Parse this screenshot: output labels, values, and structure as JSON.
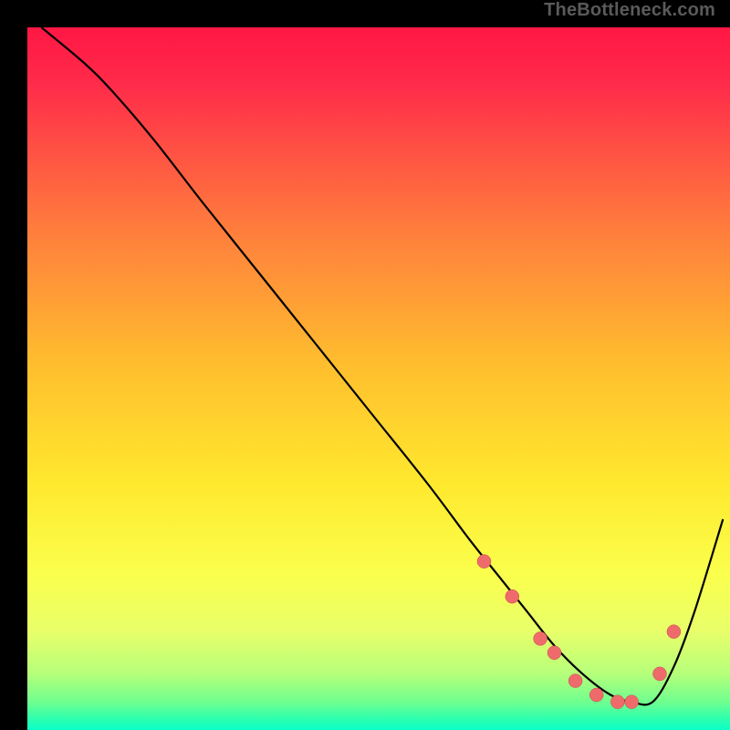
{
  "watermark": "TheBottleneck.com",
  "chart_data": {
    "type": "line",
    "title": "",
    "xlabel": "",
    "ylabel": "",
    "xlim": [
      0,
      100
    ],
    "ylim": [
      0,
      100
    ],
    "grid": false,
    "series": [
      {
        "name": "curve",
        "x": [
          2,
          8,
          12,
          18,
          25,
          33,
          41,
          49,
          57,
          63,
          67,
          71,
          75,
          79,
          83,
          86,
          89,
          92,
          95,
          99
        ],
        "y": [
          100,
          95,
          91,
          84,
          75,
          65,
          55,
          45,
          35,
          27,
          22,
          17,
          12,
          8,
          5,
          4,
          4,
          9,
          17,
          30
        ]
      }
    ],
    "markers": {
      "name": "highlight-dots",
      "x": [
        65,
        69,
        73,
        75,
        78,
        81,
        84,
        86,
        90,
        92
      ],
      "y": [
        24,
        19,
        13,
        11,
        7,
        5,
        4,
        4,
        8,
        14
      ]
    },
    "background_gradient": {
      "stops": [
        {
          "offset": 0.0,
          "color": "#ff1744"
        },
        {
          "offset": 0.08,
          "color": "#ff2b4a"
        },
        {
          "offset": 0.28,
          "color": "#ff7a3d"
        },
        {
          "offset": 0.48,
          "color": "#ffbe2e"
        },
        {
          "offset": 0.65,
          "color": "#ffe92e"
        },
        {
          "offset": 0.78,
          "color": "#faff4d"
        },
        {
          "offset": 0.86,
          "color": "#e8ff6a"
        },
        {
          "offset": 0.92,
          "color": "#b6ff7a"
        },
        {
          "offset": 0.96,
          "color": "#6fff8f"
        },
        {
          "offset": 0.985,
          "color": "#2bffb0"
        },
        {
          "offset": 1.0,
          "color": "#0affc8"
        }
      ]
    }
  }
}
